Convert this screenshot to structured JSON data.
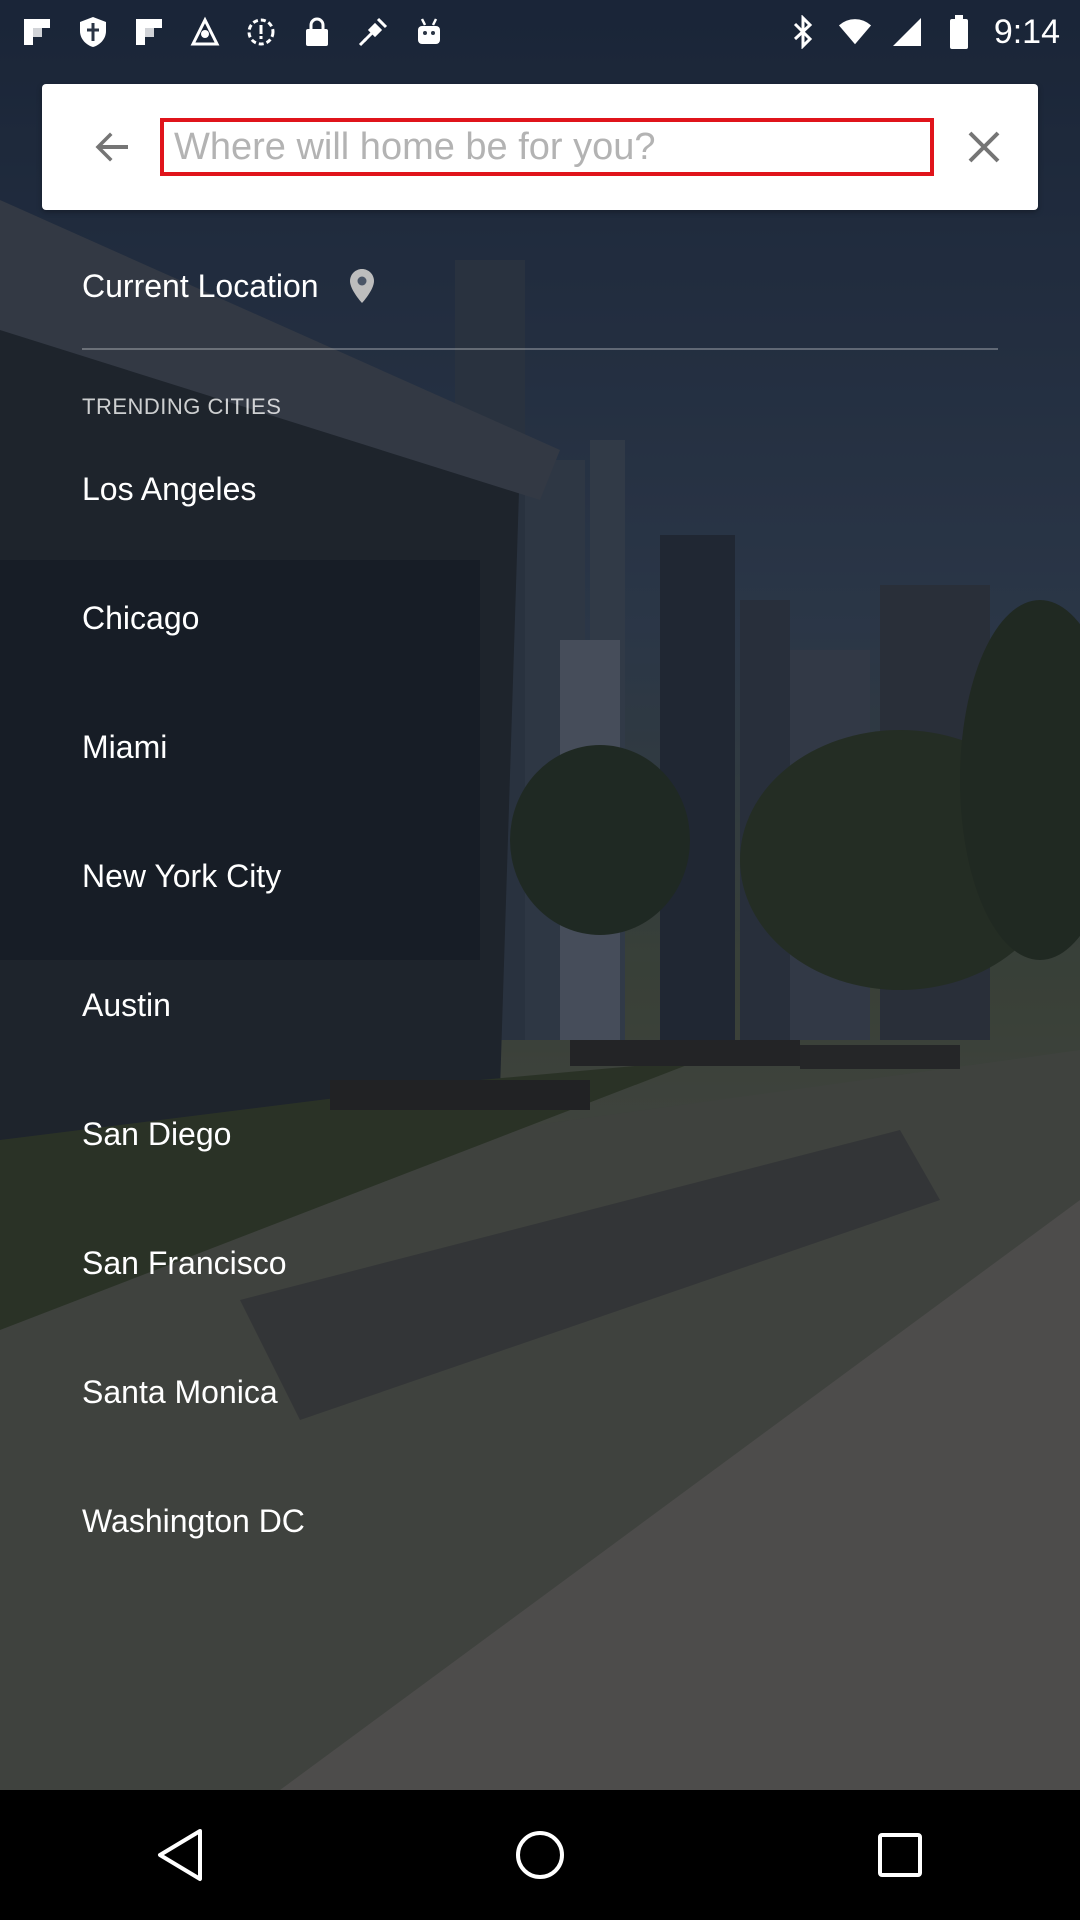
{
  "status_bar": {
    "time": "9:14",
    "left_icons": [
      "flipboard-icon",
      "shield-icon",
      "flipboard-icon",
      "maps-icon",
      "settings-alert-icon",
      "lock-icon",
      "fake-gps-icon",
      "android-icon"
    ],
    "right_icons": [
      "bluetooth-icon",
      "wifi-icon",
      "signal-icon",
      "battery-icon"
    ]
  },
  "search": {
    "placeholder": "Where will home be for you?",
    "value": "",
    "highlight_color": "#e0141b"
  },
  "current_location": {
    "label": "Current Location"
  },
  "trending": {
    "heading": "TRENDING CITIES",
    "cities": [
      "Los Angeles",
      "Chicago",
      "Miami",
      "New York City",
      "Austin",
      "San Diego",
      "San Francisco",
      "Santa Monica",
      "Washington DC"
    ]
  },
  "nav_bar": {
    "buttons": [
      "back-icon",
      "home-icon",
      "recents-icon"
    ]
  }
}
